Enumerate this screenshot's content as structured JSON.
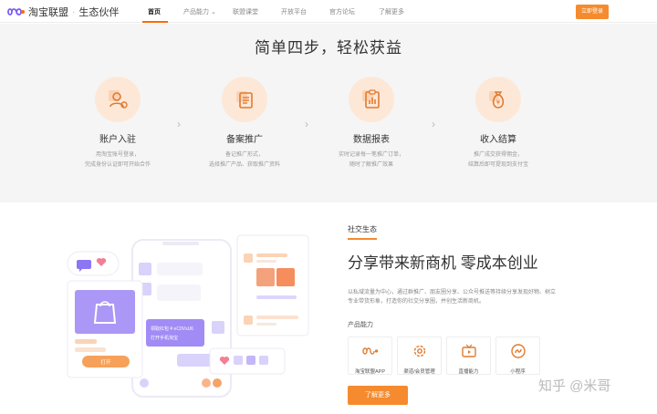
{
  "nav": {
    "logo_text": "淘宝联盟",
    "logo_sub": "生态伙伴",
    "items": [
      "首页",
      "产品能力 ⌄",
      "联盟课堂",
      "开放平台",
      "官方论坛",
      "了解更多"
    ],
    "login_label": "立即登录",
    "accent_color": "#f58b2e"
  },
  "steps": {
    "title": "简单四步，轻松获益",
    "items": [
      {
        "name": "账户入驻",
        "icon": "user-settings-icon",
        "desc1": "用淘宝账号登录，",
        "desc2": "完成身份认证即可开始合作"
      },
      {
        "name": "备案推广",
        "icon": "document-stack-icon",
        "desc1": "备记推广形式，",
        "desc2": "选择推广产品、获取推广资料"
      },
      {
        "name": "数据报表",
        "icon": "clipboard-report-icon",
        "desc1": "实时记录每一笔推广订单，",
        "desc2": "随时了解推广效果"
      },
      {
        "name": "收入结算",
        "icon": "money-bag-icon",
        "desc1": "推广成交获得佣金，",
        "desc2": "结算后即可提现到支付宝"
      }
    ]
  },
  "social": {
    "tag": "社交生态",
    "headline": "分享带来新商机 零成本创业",
    "desc": "以私域流量为中心，通过群推广、朋友圈分享、公众号推送等持续分享发现好物、树立专业带货形象，打造你的社交分享圈，并创生活新商机。",
    "capability_label": "产品能力",
    "capabilities": [
      {
        "label": "淘宝联盟APP",
        "icon": "infinity-logo-icon"
      },
      {
        "label": "渠道/会员管理",
        "icon": "gear-icon"
      },
      {
        "label": "直播能力",
        "icon": "tv-live-icon"
      },
      {
        "label": "小程序",
        "icon": "mini-program-icon"
      }
    ],
    "more_label": "了解更多"
  },
  "illustration": {
    "chat_text1": "领取红包 ¥ eC0VsU6",
    "chat_text2": "打开手机淘宝",
    "open_label": "打开"
  },
  "watermark": "知乎 @米哥"
}
